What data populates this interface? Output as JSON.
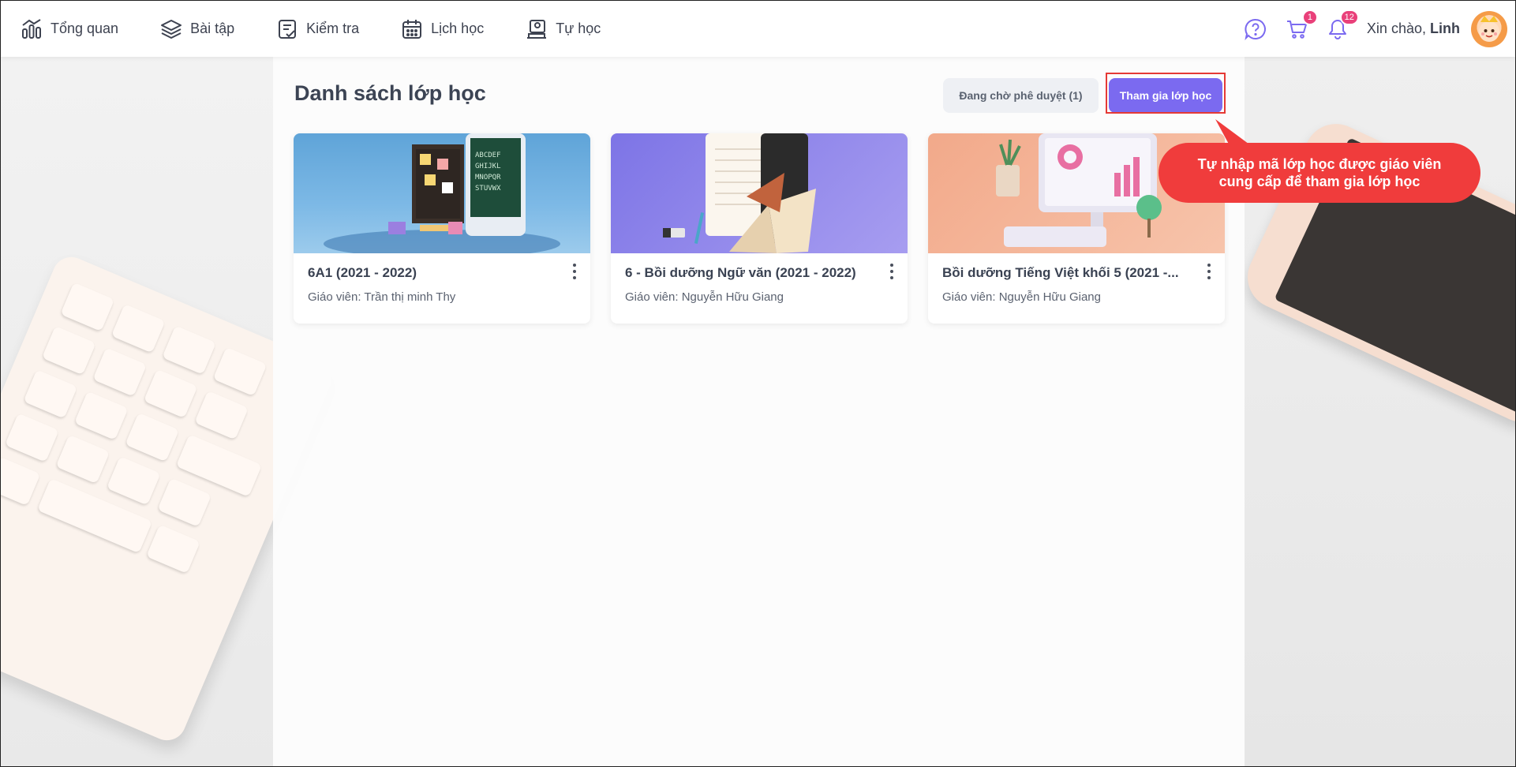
{
  "nav": {
    "items": [
      {
        "label": "Tổng quan",
        "icon": "chart-bars-icon"
      },
      {
        "label": "Bài tập",
        "icon": "layers-icon"
      },
      {
        "label": "Kiểm tra",
        "icon": "test-sheet-icon"
      },
      {
        "label": "Lịch học",
        "icon": "calendar-icon"
      },
      {
        "label": "Tự học",
        "icon": "self-study-icon"
      }
    ],
    "cart_count": "1",
    "notification_count": "12",
    "greeting": "Xin chào,",
    "user_name": "Linh"
  },
  "page": {
    "title": "Danh sách lớp học",
    "pending_button": "Đang chờ phê duyệt (1)",
    "join_button": "Tham gia lớp học"
  },
  "classes": [
    {
      "title": "6A1 (2021 - 2022)",
      "teacher": "Giáo viên: Trần thị minh Thy",
      "image": "classroom-illustration"
    },
    {
      "title": "6 - Bồi dưỡng Ngữ văn (2021 - 2022)",
      "teacher": "Giáo viên: Nguyễn Hữu Giang",
      "image": "books-illustration"
    },
    {
      "title": "Bồi dưỡng Tiếng Việt khối 5 (2021 -...",
      "teacher": "Giáo viên: Nguyễn Hữu Giang",
      "image": "computer-illustration"
    }
  ],
  "tooltip": {
    "text": "Tự nhập mã lớp học được giáo viên cung cấp để tham gia lớp học"
  },
  "colors": {
    "accent": "#7b6af0",
    "tooltip": "#f03c3c",
    "badge": "#e9407a"
  }
}
